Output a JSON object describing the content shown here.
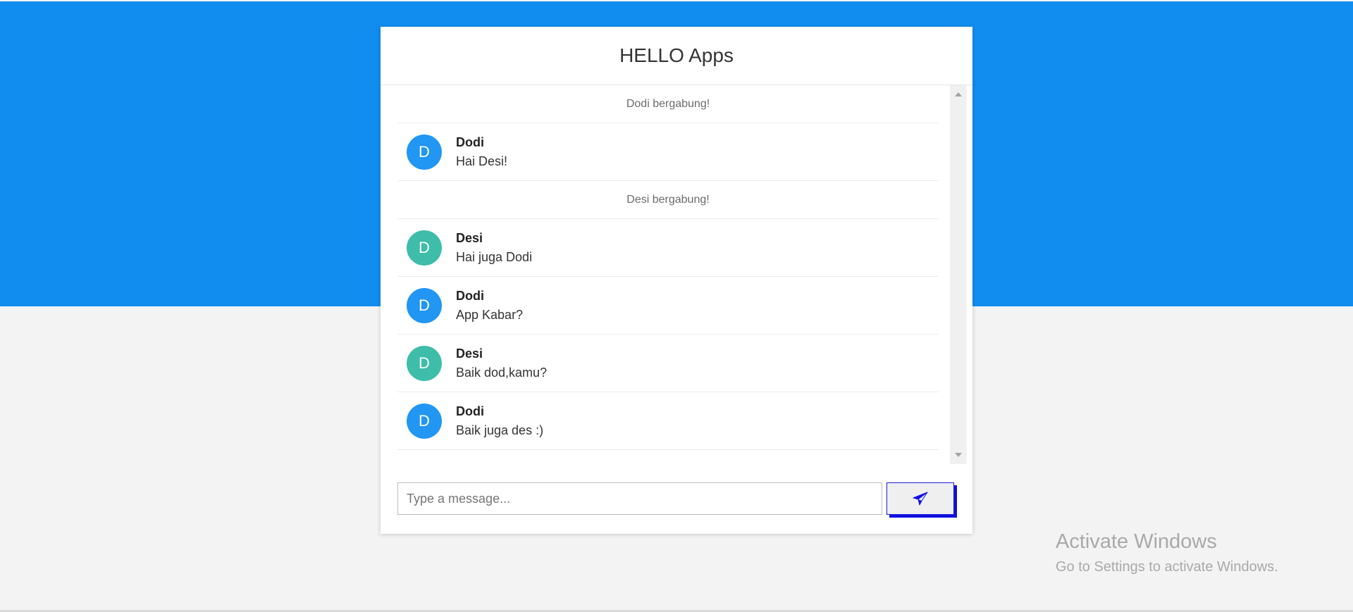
{
  "header": {
    "title": "HELLO Apps"
  },
  "messages": [
    {
      "type": "system",
      "text": "Dodi bergabung!"
    },
    {
      "type": "chat",
      "initial": "D",
      "sender": "Dodi",
      "text": "Hai Desi!",
      "avatar_color": "#2196f3"
    },
    {
      "type": "system",
      "text": "Desi bergabung!"
    },
    {
      "type": "chat",
      "initial": "D",
      "sender": "Desi",
      "text": "Hai juga Dodi",
      "avatar_color": "#3dbdaa"
    },
    {
      "type": "chat",
      "initial": "D",
      "sender": "Dodi",
      "text": "App Kabar?",
      "avatar_color": "#2196f3"
    },
    {
      "type": "chat",
      "initial": "D",
      "sender": "Desi",
      "text": "Baik dod,kamu?",
      "avatar_color": "#3dbdaa"
    },
    {
      "type": "chat",
      "initial": "D",
      "sender": "Dodi",
      "text": "Baik juga des :)",
      "avatar_color": "#2196f3"
    }
  ],
  "composer": {
    "placeholder": "Type a message...",
    "value": "",
    "send_icon": "paper-plane-icon"
  },
  "colors": {
    "background_band": "#118df0",
    "page_bg": "#f3f3f3",
    "send_accent": "#1010e0"
  },
  "watermark": {
    "title": "Activate Windows",
    "subtitle": "Go to Settings to activate Windows."
  }
}
